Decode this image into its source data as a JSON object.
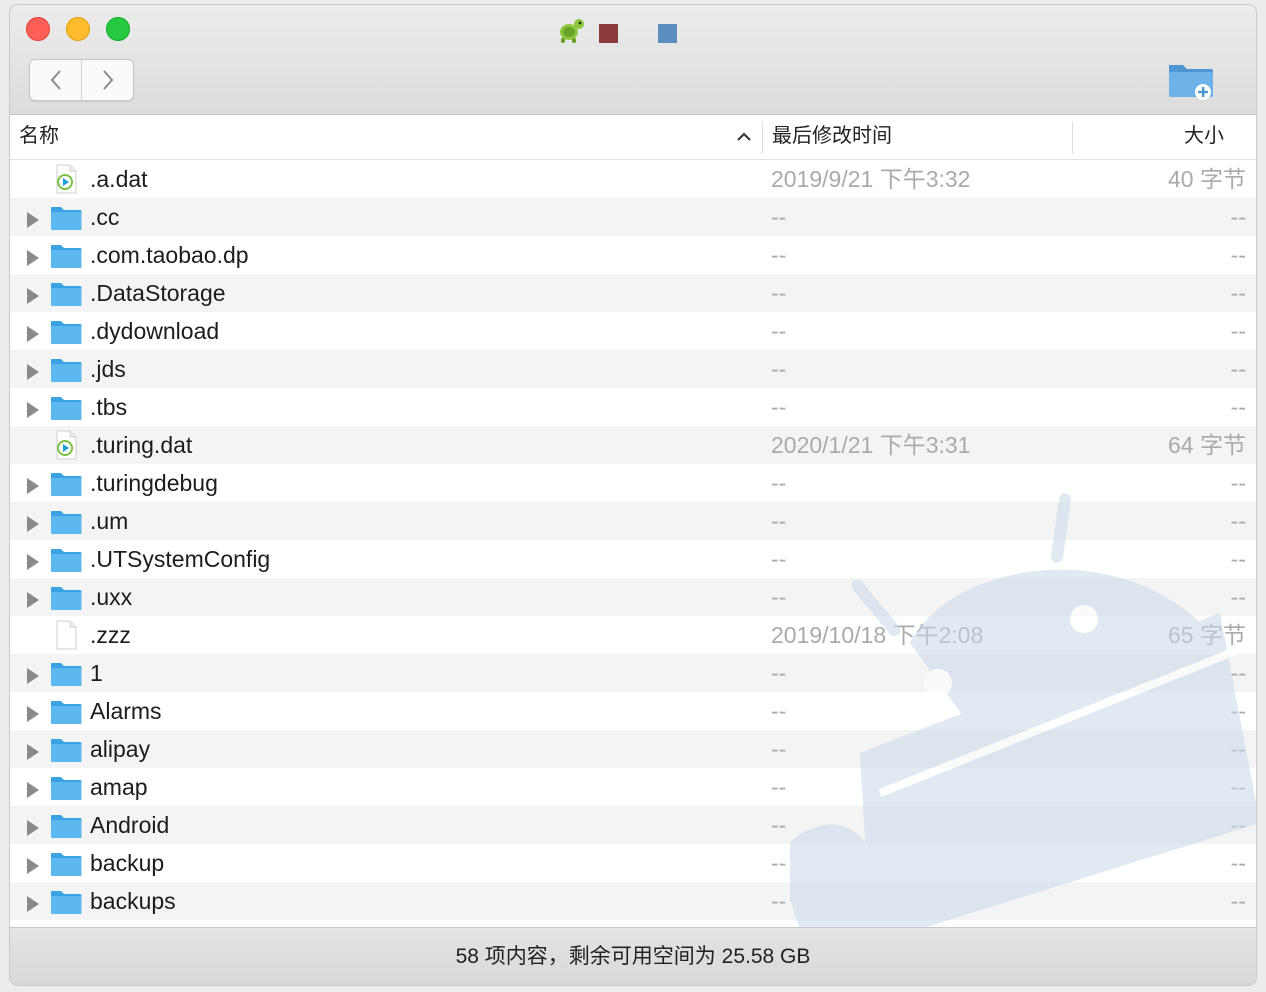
{
  "titlebar": {
    "icons": [
      "turtle-icon",
      "square-red-icon",
      "square-blue-icon"
    ]
  },
  "toolbar": {
    "back_icon": "chevron-left-icon",
    "forward_icon": "chevron-right-icon",
    "new_folder_icon": "new-folder-icon"
  },
  "header": {
    "name": "名称",
    "date": "最后修改时间",
    "size": "大小",
    "sort_icon": "chevron-up-icon"
  },
  "rows": [
    {
      "type": "file-dat",
      "name": ".a.dat",
      "date": "2019/9/21 下午3:32",
      "size": "40 字节"
    },
    {
      "type": "folder",
      "name": ".cc",
      "date": "--",
      "size": "--"
    },
    {
      "type": "folder",
      "name": ".com.taobao.dp",
      "date": "--",
      "size": "--"
    },
    {
      "type": "folder",
      "name": ".DataStorage",
      "date": "--",
      "size": "--"
    },
    {
      "type": "folder",
      "name": ".dydownload",
      "date": "--",
      "size": "--"
    },
    {
      "type": "folder",
      "name": ".jds",
      "date": "--",
      "size": "--"
    },
    {
      "type": "folder",
      "name": ".tbs",
      "date": "--",
      "size": "--"
    },
    {
      "type": "file-dat",
      "name": ".turing.dat",
      "date": "2020/1/21 下午3:31",
      "size": "64 字节"
    },
    {
      "type": "folder",
      "name": ".turingdebug",
      "date": "--",
      "size": "--"
    },
    {
      "type": "folder",
      "name": ".um",
      "date": "--",
      "size": "--"
    },
    {
      "type": "folder",
      "name": ".UTSystemConfig",
      "date": "--",
      "size": "--"
    },
    {
      "type": "folder",
      "name": ".uxx",
      "date": "--",
      "size": "--"
    },
    {
      "type": "file-blank",
      "name": ".zzz",
      "date": "2019/10/18 下午2:08",
      "size": "65 字节"
    },
    {
      "type": "folder",
      "name": "1",
      "date": "--",
      "size": "--"
    },
    {
      "type": "folder",
      "name": "Alarms",
      "date": "--",
      "size": "--"
    },
    {
      "type": "folder",
      "name": "alipay",
      "date": "--",
      "size": "--"
    },
    {
      "type": "folder",
      "name": "amap",
      "date": "--",
      "size": "--"
    },
    {
      "type": "folder",
      "name": "Android",
      "date": "--",
      "size": "--"
    },
    {
      "type": "folder",
      "name": "backup",
      "date": "--",
      "size": "--"
    },
    {
      "type": "folder",
      "name": "backups",
      "date": "--",
      "size": "--"
    }
  ],
  "status": {
    "text": "58 项内容，剩余可用空间为 25.58 GB"
  },
  "colors": {
    "folder": "#5cb8ee",
    "watermark": "#c9d8ea"
  }
}
